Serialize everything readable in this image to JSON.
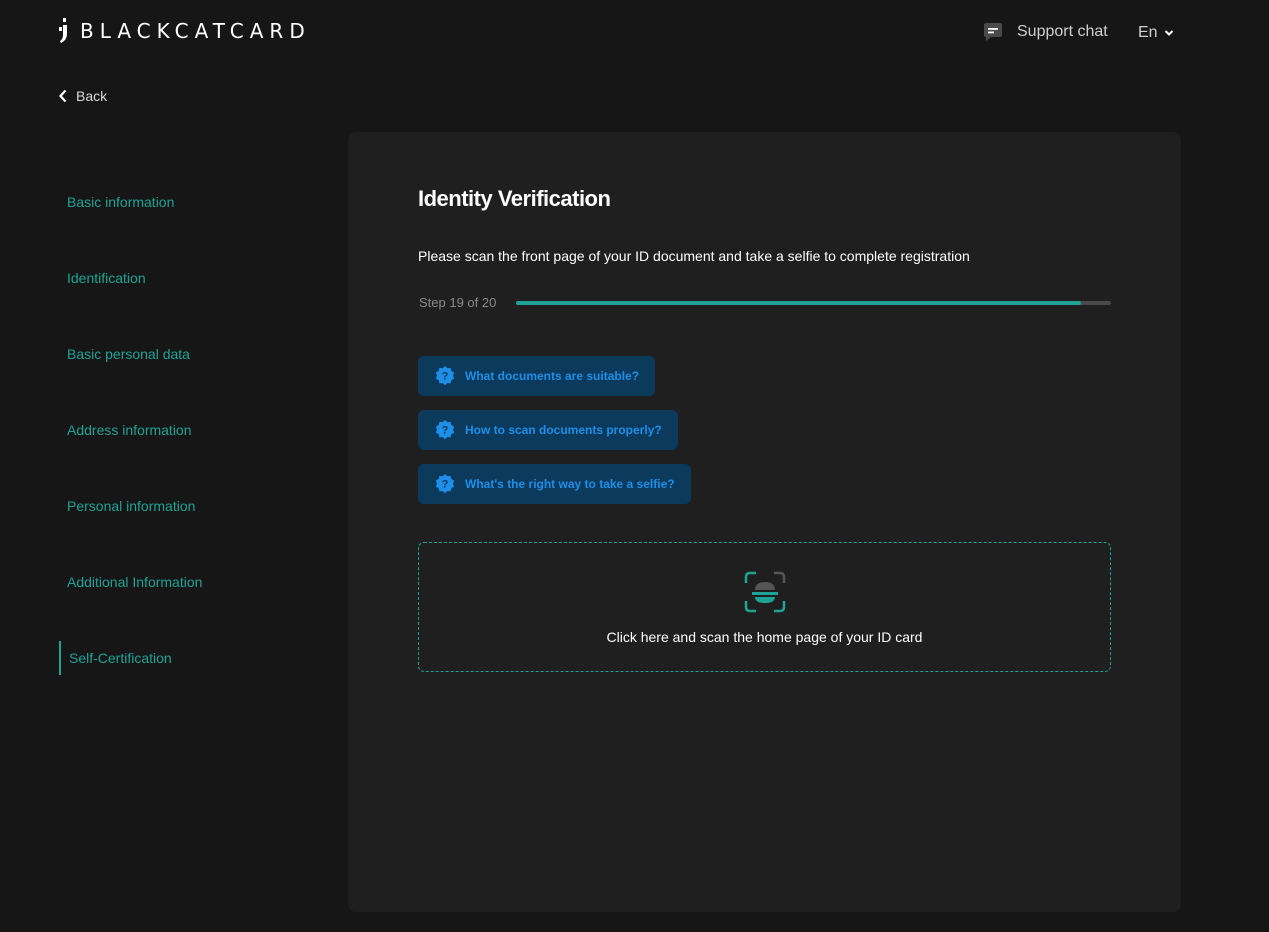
{
  "header": {
    "logo_text": "BLACKCATCARD",
    "support_label": "Support chat",
    "language": "En"
  },
  "nav": {
    "back_label": "Back"
  },
  "sidebar": {
    "items": [
      {
        "label": "Basic information"
      },
      {
        "label": "Identification"
      },
      {
        "label": "Basic personal data"
      },
      {
        "label": "Address information"
      },
      {
        "label": "Personal information"
      },
      {
        "label": "Additional Information"
      },
      {
        "label": "Self-Certification",
        "active": true
      }
    ]
  },
  "main": {
    "title": "Identity Verification",
    "subtitle": "Please scan the front page of your ID document and take a selfie to complete registration",
    "step_label": "Step 19 of 20",
    "progress": {
      "current": 19,
      "total": 20
    },
    "help_buttons": [
      {
        "label": "What documents are suitable?"
      },
      {
        "label": "How to scan documents properly?"
      },
      {
        "label": "What's the right way to take a selfie?"
      }
    ],
    "upload_label": "Click here and scan the home page of your ID card"
  },
  "colors": {
    "accent": "#1fa396",
    "help_text": "#1d8fe8",
    "help_bg": "#0b3a5c",
    "background": "#161616",
    "panel": "#1f1f1f"
  },
  "icons": {
    "support": "chat-bubble-icon",
    "language": "chevron-down-icon",
    "back": "chevron-left-icon",
    "help": "question-badge-icon",
    "upload": "scan-id-icon"
  }
}
